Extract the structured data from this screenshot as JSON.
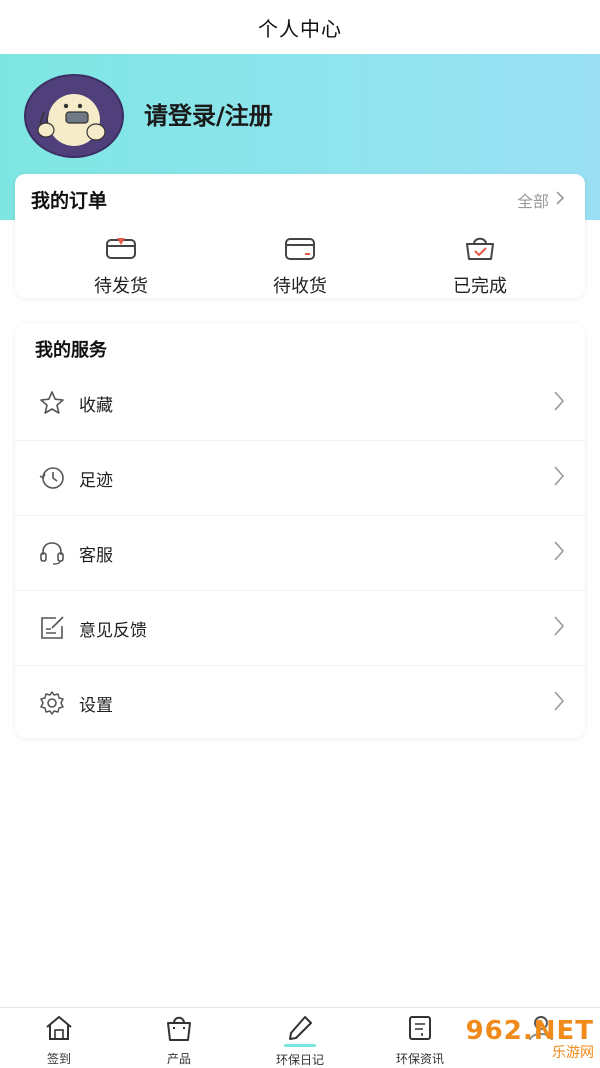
{
  "header": {
    "title": "个人中心"
  },
  "profile": {
    "login_text": "请登录/注册"
  },
  "orders": {
    "title": "我的订单",
    "all_label": "全部",
    "items": [
      {
        "label": "待发货",
        "icon": "box-pending-icon"
      },
      {
        "label": "待收货",
        "icon": "wallet-receive-icon"
      },
      {
        "label": "已完成",
        "icon": "bag-complete-icon"
      }
    ]
  },
  "services": {
    "title": "我的服务",
    "items": [
      {
        "label": "收藏",
        "icon": "star-icon"
      },
      {
        "label": "足迹",
        "icon": "history-clock-icon"
      },
      {
        "label": "客服",
        "icon": "headset-icon"
      },
      {
        "label": "意见反馈",
        "icon": "edit-note-icon"
      },
      {
        "label": "设置",
        "icon": "gear-icon"
      }
    ]
  },
  "tabbar": {
    "items": [
      {
        "label": "签到",
        "icon": "home-icon"
      },
      {
        "label": "产品",
        "icon": "shopping-bag-icon"
      },
      {
        "label": "环保日记",
        "icon": "pen-icon",
        "active": true
      },
      {
        "label": "环保资讯",
        "icon": "document-icon"
      },
      {
        "label": "",
        "icon": "user-icon"
      }
    ]
  },
  "watermark": {
    "line1": "962.NET",
    "line2": "乐游网"
  },
  "colors": {
    "accent": "#7ee6e2",
    "hero_right": "#9adff3",
    "order_icon_red": "#e85a4a"
  }
}
